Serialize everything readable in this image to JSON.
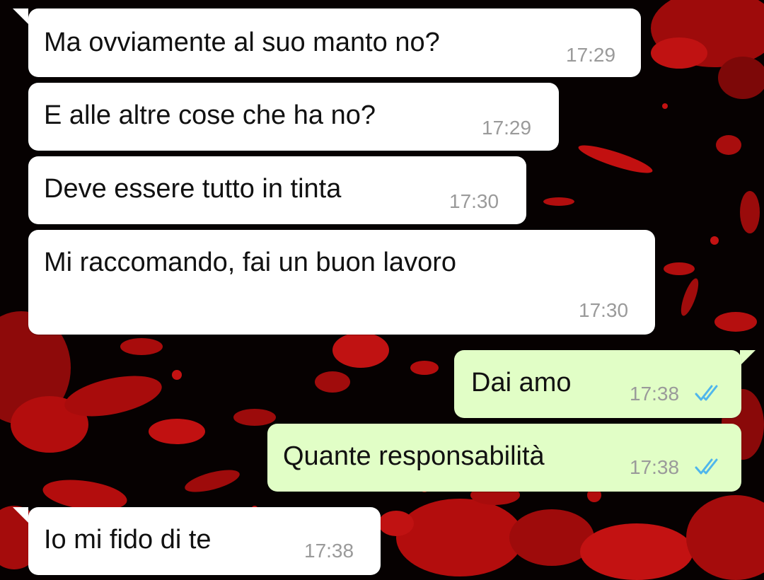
{
  "messages": [
    {
      "direction": "in",
      "text": "Ma ovviamente al suo manto no?",
      "time": "17:29"
    },
    {
      "direction": "in",
      "text": "E alle altre cose che ha no?",
      "time": "17:29"
    },
    {
      "direction": "in",
      "text": "Deve essere tutto in tinta",
      "time": "17:30"
    },
    {
      "direction": "in",
      "text": "Mi raccomando, fai un buon lavoro",
      "time": "17:30"
    },
    {
      "direction": "out",
      "text": "Dai amo",
      "time": "17:38",
      "status": "read",
      "status_icon": "double-check-icon"
    },
    {
      "direction": "out",
      "text": "Quante responsabilità",
      "time": "17:38",
      "status": "read",
      "status_icon": "double-check-icon"
    },
    {
      "direction": "in",
      "text": "Io mi fido di te",
      "time": "17:38"
    }
  ],
  "colors": {
    "incoming_bubble": "#ffffff",
    "outgoing_bubble": "#e1fec6",
    "message_text": "#111111",
    "timestamp": "#9a9a9a",
    "read_ticks": "#4fb6ec",
    "wallpaper_base": "#060101",
    "wallpaper_splatter": "#b30d0d"
  },
  "wallpaper": {
    "style": "red-paint-splatter-on-black"
  }
}
